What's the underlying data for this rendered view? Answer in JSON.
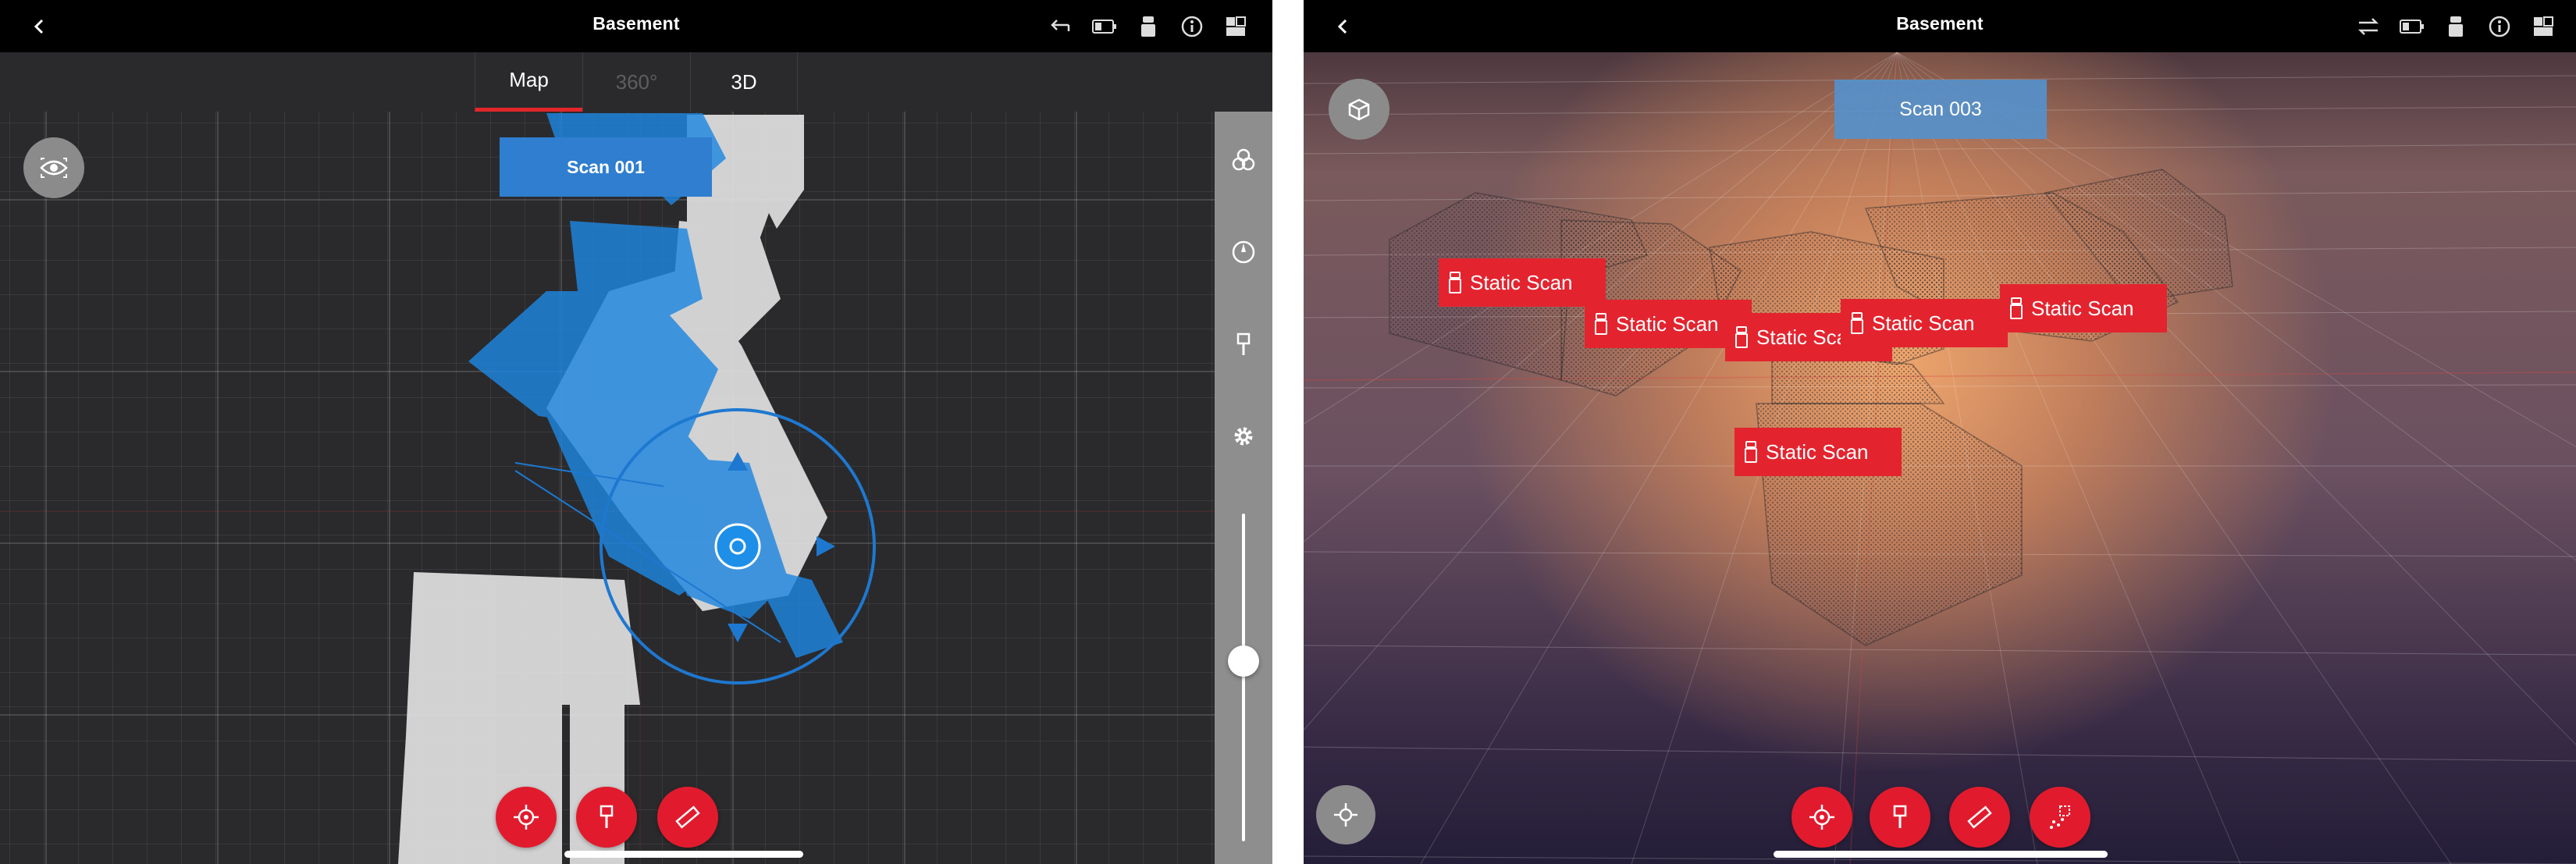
{
  "left_screen": {
    "topbar": {
      "title": "Basement"
    },
    "tabs": [
      {
        "label": "Map",
        "state": "active"
      },
      {
        "label": "360°",
        "state": "disabled"
      },
      {
        "label": "3D",
        "state": "normal"
      }
    ],
    "scan_label": "Scan 001",
    "view_toggle_icon": "eye-icon",
    "top_icons": [
      "undo-icon",
      "battery-icon",
      "scanner-device-icon",
      "info-icon",
      "layout-icon"
    ],
    "sidebar_icons": [
      "layers-icon",
      "compass-icon",
      "pin-icon",
      "gear-icon"
    ],
    "slider_level": 0.45,
    "toolbar_icons": [
      "target-icon",
      "pin-icon",
      "ruler-icon"
    ],
    "colors": {
      "accent": "#e11b2d",
      "scan_blue": "#2f7ecf",
      "background": "#2a2a2c",
      "topbar": "#000000"
    }
  },
  "right_screen": {
    "topbar": {
      "title": "Basement"
    },
    "scan_label": "Scan 003",
    "view_icon": "cube-icon",
    "top_icons": [
      "swap-icon",
      "battery-icon",
      "scanner-device-icon",
      "info-icon",
      "layout-icon"
    ],
    "static_scans": [
      {
        "label": "Static Scan"
      },
      {
        "label": "Static Scan"
      },
      {
        "label": "Static Scan"
      },
      {
        "label": "Static Scan"
      },
      {
        "label": "Static Scan"
      },
      {
        "label": "Static Scan"
      }
    ],
    "toolbar_icons": [
      "target-icon",
      "pin-icon",
      "ruler-icon",
      "point-select-icon"
    ],
    "bottom_left_icon": "move-icon",
    "colors": {
      "tag_red": "#e3242f",
      "scan_blue": "#5491cd"
    }
  }
}
